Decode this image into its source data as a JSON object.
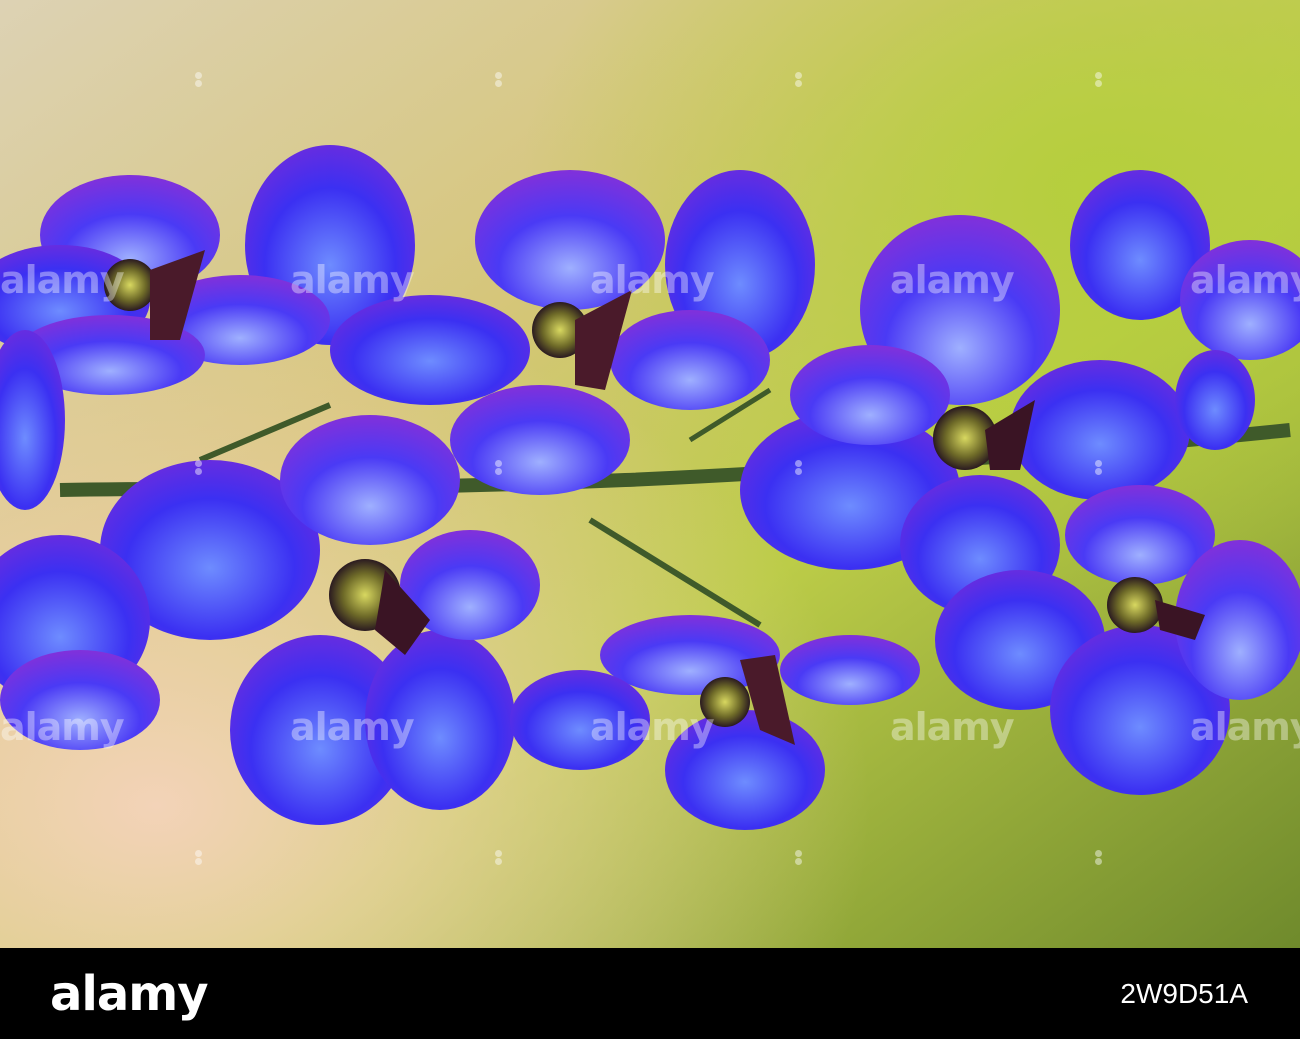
{
  "watermark": {
    "text": "alamy"
  },
  "footer": {
    "logo": "alamy",
    "image_id": "2W9D51A"
  },
  "colors": {
    "petal_blue": "#3a2cf0",
    "petal_violet": "#7a2ce0",
    "background_green": "#b9cc4a",
    "background_peach": "#e8c9a8",
    "footer_bg": "#000000"
  }
}
